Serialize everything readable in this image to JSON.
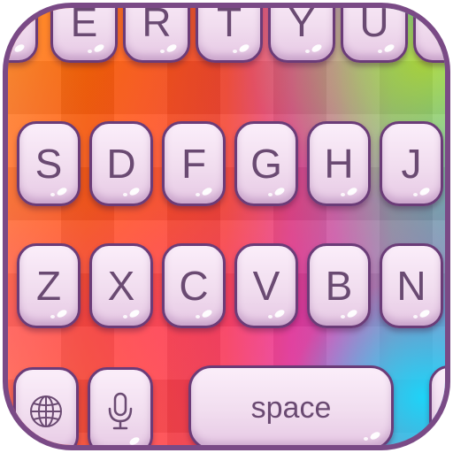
{
  "keyboard": {
    "row1": [
      "",
      "E",
      "R",
      "T",
      "Y",
      "U",
      ""
    ],
    "row2": [
      "S",
      "D",
      "F",
      "G",
      "H",
      "J"
    ],
    "row3": [
      "Z",
      "X",
      "C",
      "V",
      "B",
      "N"
    ],
    "space_label": "space"
  },
  "icons": {
    "globe": "globe-icon",
    "mic": "microphone-icon"
  },
  "colors": {
    "border": "#7a4a86",
    "key_text": "#6a4a72",
    "key_face": "#f1ddef"
  }
}
